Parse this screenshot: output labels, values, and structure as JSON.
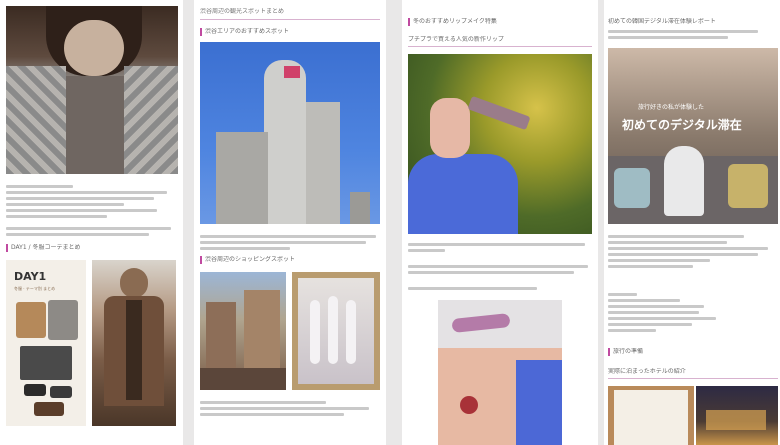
{
  "col1": {
    "section_heading": "DAY1 / 冬服コーデまとめ",
    "collage_title": "DAY1",
    "collage_subtitle": "冬服 · テーマ別 まとめ"
  },
  "col2": {
    "title": "渋谷周辺の観光スポットまとめ",
    "heading1": "渋谷エリアのおすすめスポット",
    "heading2": "渋谷周辺のショッピングスポット"
  },
  "col3": {
    "title": "冬のおすすめリップメイク特集",
    "heading1": "プチプラで買える人気の新作リップ"
  },
  "col4": {
    "title": "初めての韓国デジタル滞在体験レポート",
    "banner_text": "初めてのデジタル滞在",
    "banner_small": "旅行好きの私が体験した",
    "heading1": "旅行の準備",
    "heading2": "実際に泊まったホテルの紹介"
  }
}
